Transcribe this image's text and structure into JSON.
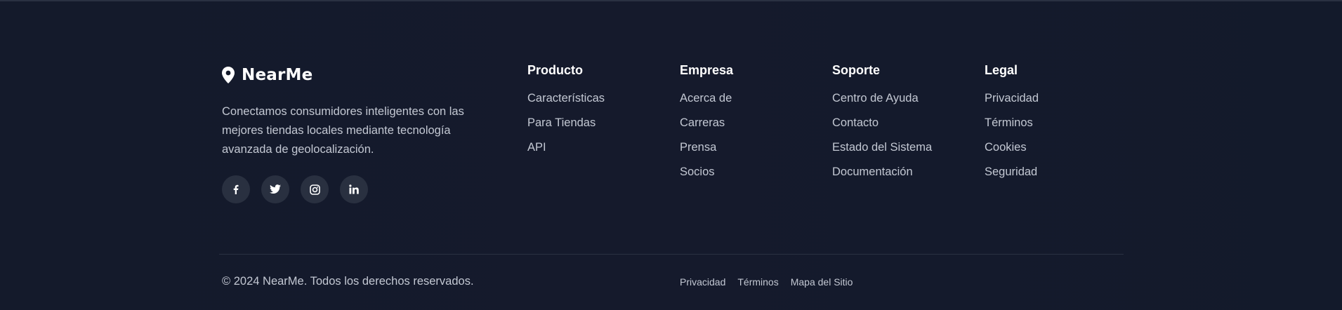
{
  "brand": {
    "name": "NearMe",
    "tagline": "Conectamos consumidores inteligentes con las mejores tiendas locales mediante tecnología avanzada de geolocalización.",
    "icon": "map-pin-icon"
  },
  "socials": [
    {
      "icon": "facebook-icon"
    },
    {
      "icon": "twitter-icon"
    },
    {
      "icon": "instagram-icon"
    },
    {
      "icon": "linkedin-icon"
    }
  ],
  "columns": {
    "producto": {
      "title": "Producto",
      "links": [
        "Características",
        "Para Tiendas",
        "API"
      ]
    },
    "empresa": {
      "title": "Empresa",
      "links": [
        "Acerca de",
        "Carreras",
        "Prensa",
        "Socios"
      ]
    },
    "soporte": {
      "title": "Soporte",
      "links": [
        "Centro de Ayuda",
        "Contacto",
        "Estado del Sistema",
        "Documentación"
      ]
    },
    "legal": {
      "title": "Legal",
      "links": [
        "Privacidad",
        "Términos",
        "Cookies",
        "Seguridad"
      ]
    }
  },
  "bottom": {
    "copyright": "© 2024 NearMe. Todos los derechos reservados.",
    "links": [
      "Privacidad",
      "Términos",
      "Mapa del Sitio"
    ]
  },
  "colors": {
    "background": "#141a2b",
    "text": "#c3c8d3",
    "heading": "#ffffff",
    "social_bg": "#293040",
    "divider": "#2a3142"
  }
}
